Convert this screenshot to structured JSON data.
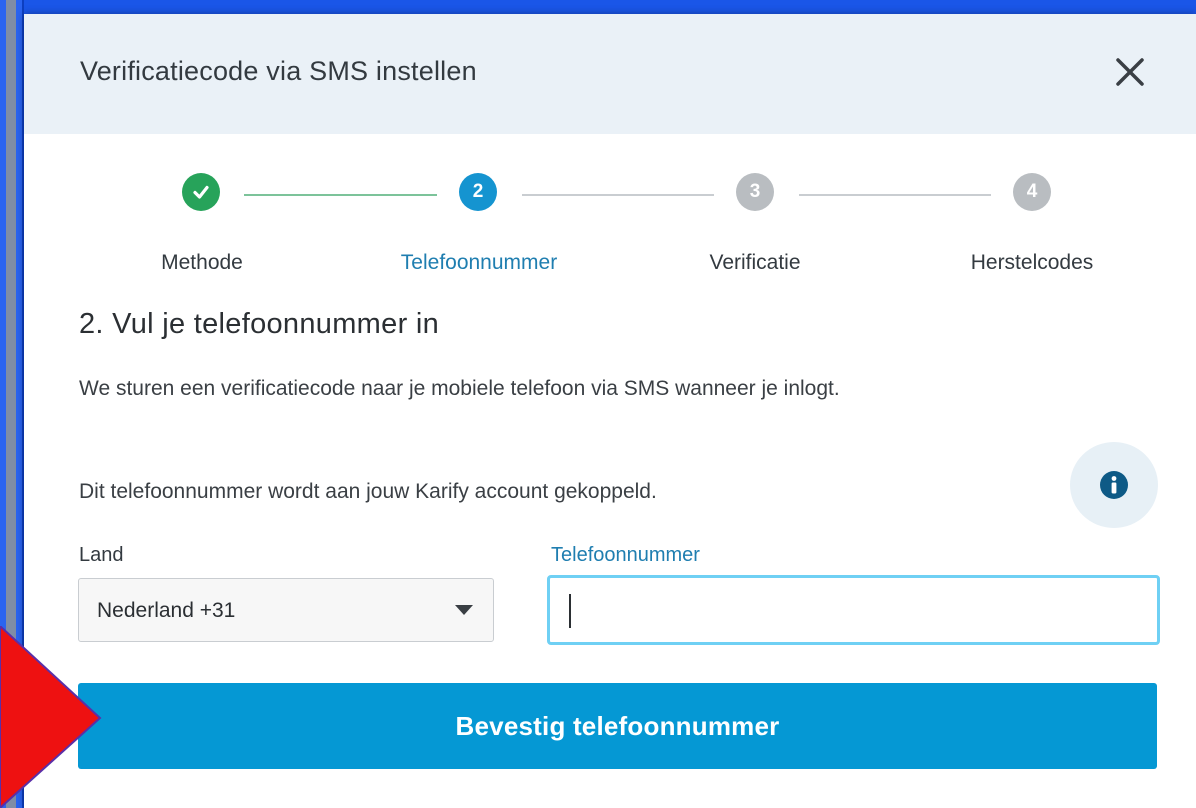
{
  "modal": {
    "title": "Verificatiecode via SMS instellen"
  },
  "stepper": {
    "steps": [
      {
        "label": "Methode",
        "number": "",
        "state": "done"
      },
      {
        "label": "Telefoonnummer",
        "number": "2",
        "state": "active"
      },
      {
        "label": "Verificatie",
        "number": "3",
        "state": "upcoming"
      },
      {
        "label": "Herstelcodes",
        "number": "4",
        "state": "upcoming"
      }
    ],
    "colors": {
      "done": "#27a35a",
      "active": "#1594d0",
      "upcoming": "#b9bdc1"
    }
  },
  "content": {
    "heading": "2. Vul je telefoonnummer in",
    "description": "We sturen een verificatiecode naar je mobiele telefoon via SMS wanneer je inlogt.",
    "account_note": "Dit telefoonnummer wordt aan jouw Karify account gekoppeld."
  },
  "form": {
    "country_label": "Land",
    "country_value": "Nederland +31",
    "phone_label": "Telefoonnummer",
    "phone_value": "",
    "submit_label": "Bevestig telefoonnummer"
  },
  "icons": {
    "close": "close-icon",
    "info": "info-icon",
    "check": "check-icon",
    "dropdown": "chevron-down-icon",
    "annotation": "red-arrow-icon"
  }
}
